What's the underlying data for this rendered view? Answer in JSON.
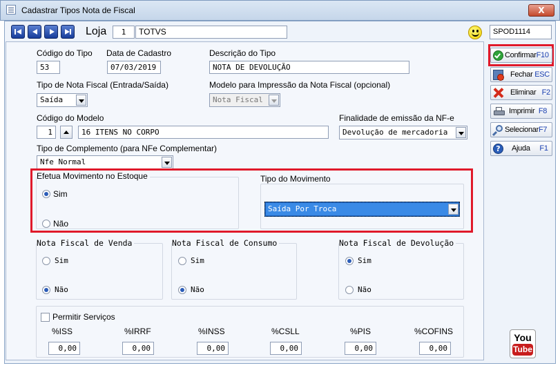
{
  "window": {
    "title": "Cadastrar Tipos Nota de Fiscal",
    "close": "X"
  },
  "header": {
    "loja_label": "Loja",
    "loja_num": "1",
    "loja_name": "TOTVS",
    "user_code": "SPOD1114"
  },
  "form": {
    "codigo_tipo": {
      "label": "Código do Tipo",
      "value": "53"
    },
    "data_cadastro": {
      "label": "Data de Cadastro",
      "value": "07/03/2019"
    },
    "descricao": {
      "label": "Descrição do Tipo",
      "value": "NOTA DE DEVOLUÇÃO"
    },
    "tipo_nota": {
      "label": "Tipo de Nota Fiscal (Entrada/Saída)",
      "value": "Saída"
    },
    "modelo_impressao": {
      "label": "Modelo para Impressão da Nota Fiscal (opcional)",
      "value": "Nota Fiscal"
    },
    "codigo_modelo": {
      "label": "Código do Modelo",
      "num": "1",
      "desc": "16 ITENS NO CORPO"
    },
    "finalidade": {
      "label": "Finalidade de emissão da NF-e",
      "value": "Devolução de mercadoria"
    },
    "tipo_complemento": {
      "label": "Tipo de Complemento (para NFe Complementar)",
      "value": "Nfe Normal"
    }
  },
  "estoque": {
    "label": "Efetua Movimento no Estoque",
    "sim": "Sim",
    "nao": "Não",
    "selected": "sim"
  },
  "movimento": {
    "label": "Tipo do Movimento",
    "value": "Saída Por Troca"
  },
  "groups": [
    {
      "label": "Nota Fiscal de Venda",
      "sim": "Sim",
      "nao": "Não",
      "selected": "nao"
    },
    {
      "label": "Nota Fiscal de Consumo",
      "sim": "Sim",
      "nao": "Não",
      "selected": "nao"
    },
    {
      "label": "Nota Fiscal de Devolução",
      "sim": "Sim",
      "nao": "Não",
      "selected": "sim"
    }
  ],
  "servicos": {
    "checkbox_label": "Permitir Serviços",
    "taxes": [
      {
        "label": "%ISS",
        "value": "0,00"
      },
      {
        "label": "%IRRF",
        "value": "0,00"
      },
      {
        "label": "%INSS",
        "value": "0,00"
      },
      {
        "label": "%CSLL",
        "value": "0,00"
      },
      {
        "label": "%PIS",
        "value": "0,00"
      },
      {
        "label": "%COFINS",
        "value": "0,00"
      }
    ]
  },
  "sidebar": {
    "buttons": [
      {
        "label": "Confirmar",
        "key": "F10",
        "icon": "check-icon"
      },
      {
        "label": "Fechar",
        "key": "ESC",
        "icon": "close-door-icon"
      },
      {
        "label": "Eliminar",
        "key": "F2",
        "icon": "delete-x-icon"
      },
      {
        "label": "Imprimir",
        "key": "F8",
        "icon": "printer-icon"
      },
      {
        "label": "Selecionar",
        "key": "F7",
        "icon": "magnifier-icon"
      },
      {
        "label": "Ajuda",
        "key": "F1",
        "icon": "help-icon"
      }
    ],
    "youtube": {
      "top": "You",
      "bottom": "Tube"
    }
  },
  "colors": {
    "highlight": "#e0192a",
    "selection": "#3a8ae6",
    "accent": "#1a3fb0"
  }
}
